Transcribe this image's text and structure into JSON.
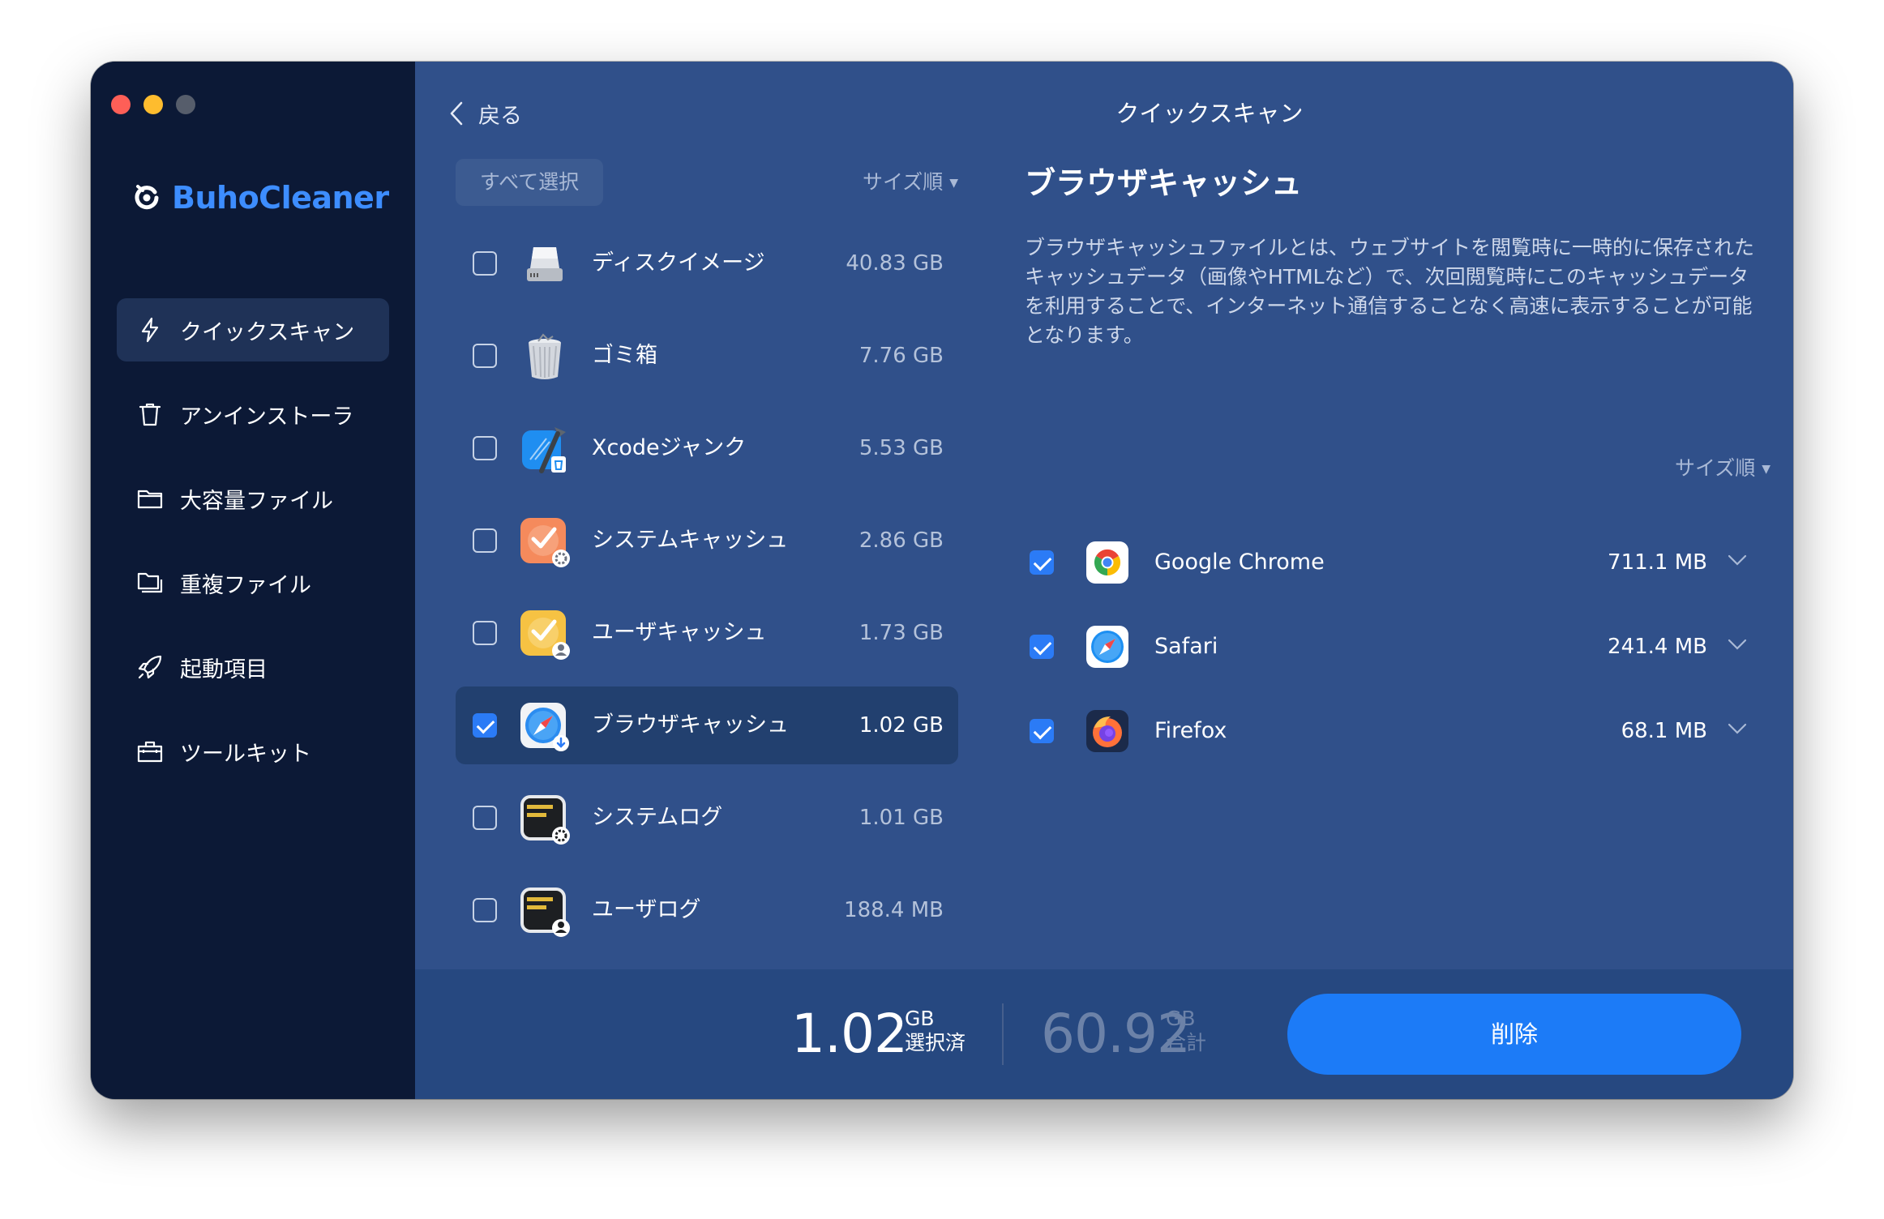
{
  "app": {
    "name": "BuhoCleaner"
  },
  "colors": {
    "accent": "#1c7bf7",
    "brand": "#3d8dff",
    "sidebar": "#0c1936",
    "panel": "#30508a"
  },
  "sidebar": {
    "items": [
      {
        "label": "クイックスキャン",
        "icon": "lightning-icon",
        "active": true
      },
      {
        "label": "アンインストーラ",
        "icon": "trash-icon"
      },
      {
        "label": "大容量ファイル",
        "icon": "folder-icon"
      },
      {
        "label": "重複ファイル",
        "icon": "duplicate-folder-icon"
      },
      {
        "label": "起動項目",
        "icon": "rocket-icon"
      },
      {
        "label": "ツールキット",
        "icon": "toolbox-icon"
      }
    ]
  },
  "header": {
    "back_label": "戻る",
    "title": "クイックスキャン"
  },
  "list": {
    "select_all_label": "すべて選択",
    "sort_label": "サイズ順",
    "items": [
      {
        "label": "ディスクイメージ",
        "size": "40.83 GB",
        "checked": false,
        "icon": "disk-image-icon"
      },
      {
        "label": "ゴミ箱",
        "size": "7.76 GB",
        "checked": false,
        "icon": "trash-bin-icon"
      },
      {
        "label": "Xcodeジャンク",
        "size": "5.53 GB",
        "checked": false,
        "icon": "xcode-icon"
      },
      {
        "label": "システムキャッシュ",
        "size": "2.86 GB",
        "checked": false,
        "icon": "system-cache-icon"
      },
      {
        "label": "ユーザキャッシュ",
        "size": "1.73 GB",
        "checked": false,
        "icon": "user-cache-icon"
      },
      {
        "label": "ブラウザキャッシュ",
        "size": "1.02 GB",
        "checked": true,
        "icon": "browser-cache-icon"
      },
      {
        "label": "システムログ",
        "size": "1.01 GB",
        "checked": false,
        "icon": "system-log-icon"
      },
      {
        "label": "ユーザログ",
        "size": "188.4 MB",
        "checked": false,
        "icon": "user-log-icon"
      }
    ]
  },
  "detail": {
    "title": "ブラウザキャッシュ",
    "description": "ブラウザキャッシュファイルとは、ウェブサイトを閲覧時に一時的に保存されたキャッシュデータ（画像やHTMLなど）で、次回閲覧時にこのキャッシュデータを利用することで、インターネット通信することなく高速に表示することが可能となります。",
    "sort_label": "サイズ順",
    "browsers": [
      {
        "name": "Google Chrome",
        "size": "711.1 MB",
        "checked": true,
        "icon": "chrome-icon"
      },
      {
        "name": "Safari",
        "size": "241.4 MB",
        "checked": true,
        "icon": "safari-icon"
      },
      {
        "name": "Firefox",
        "size": "68.1 MB",
        "checked": true,
        "icon": "firefox-icon"
      }
    ]
  },
  "footer": {
    "selected_value": "1.02",
    "selected_unit": "GB",
    "selected_caption": "選択済",
    "total_value": "60.92",
    "total_unit": "GB",
    "total_caption": "合計",
    "delete_label": "削除"
  }
}
